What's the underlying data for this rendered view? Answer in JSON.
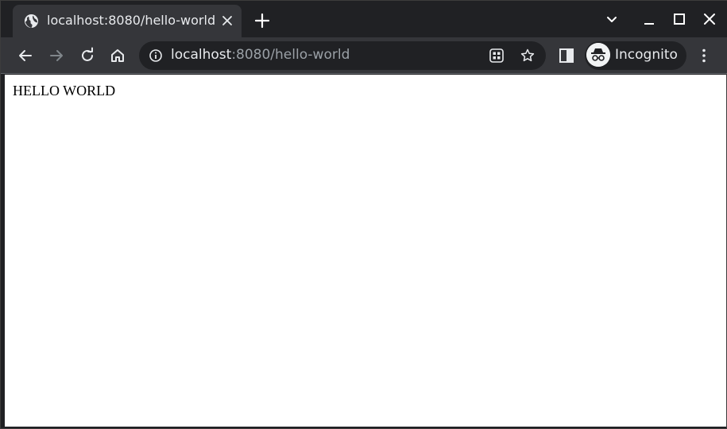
{
  "tab": {
    "title": "localhost:8080/hello-world",
    "favicon": "globe-icon"
  },
  "toolbar": {
    "url_host": "localhost",
    "url_rest": ":8080/hello-world",
    "profile_label": "Incognito"
  },
  "page": {
    "body_text": "HELLO WORLD"
  },
  "colors": {
    "frame": "#202124",
    "toolbar": "#35363a",
    "text": "#e8eaed",
    "muted": "#9aa0a6"
  }
}
